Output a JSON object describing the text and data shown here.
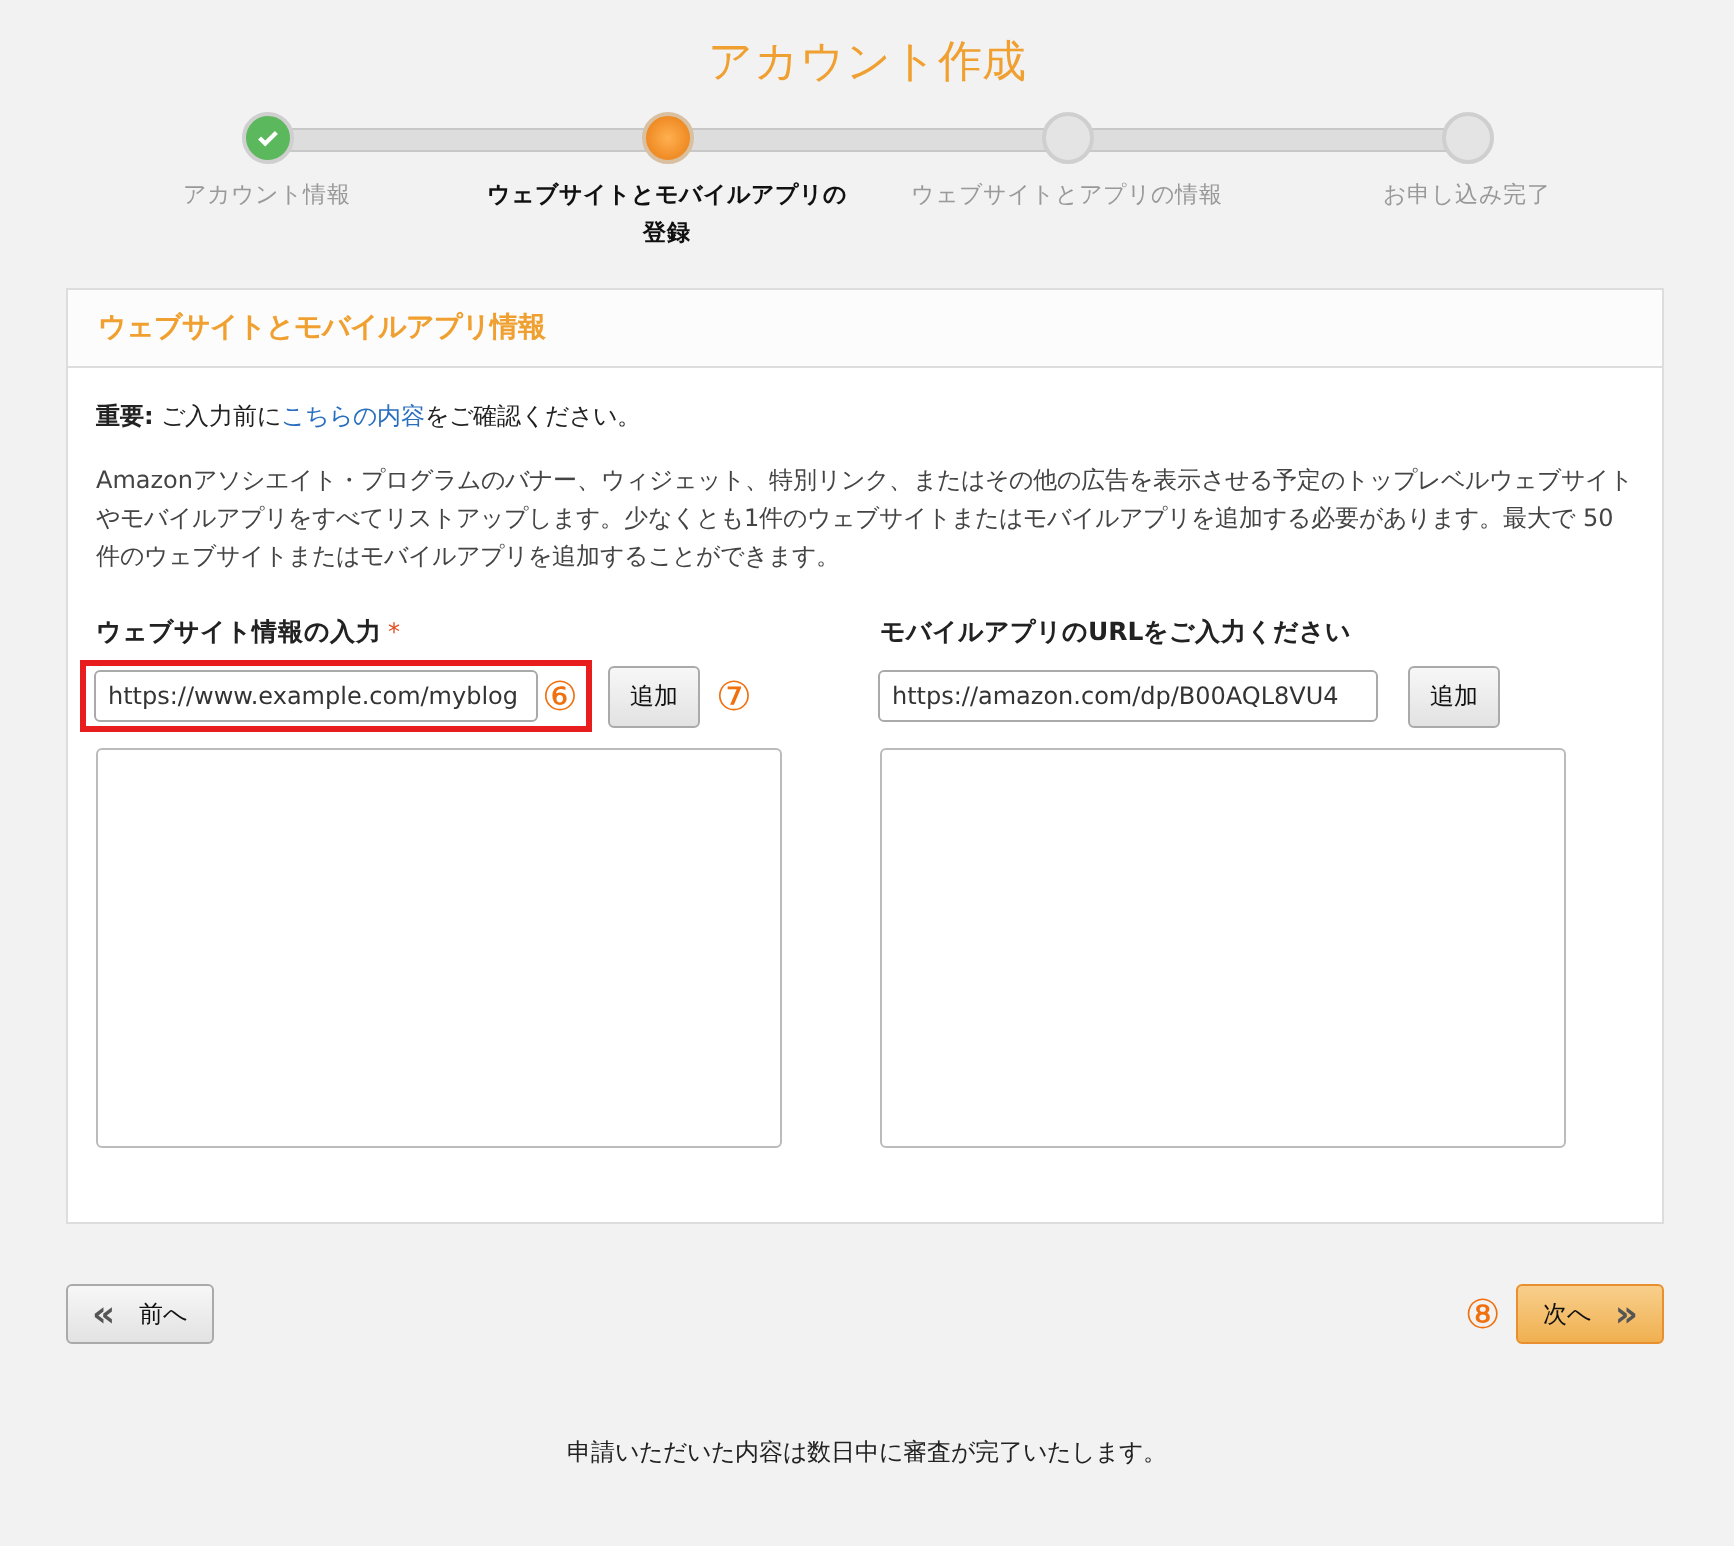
{
  "title": "アカウント作成",
  "steps": [
    {
      "label": "アカウント情報",
      "done": true,
      "selected": false
    },
    {
      "label": "ウェブサイトとモバイルアプリの登録",
      "done": false,
      "selected": true
    },
    {
      "label": "ウェブサイトとアプリの情報",
      "done": false,
      "selected": false
    },
    {
      "label": "お申し込み完了",
      "done": false,
      "selected": false
    }
  ],
  "card": {
    "heading": "ウェブサイトとモバイルアプリ情報",
    "notice": {
      "label": "重要:",
      "before": " ご入力前に",
      "link": "こちらの内容",
      "after": "をご確認ください。"
    },
    "description": "Amazonアソシエイト・プログラムのバナー、ウィジェット、特別リンク、またはその他の広告を表示させる予定のトップレベルウェブサイトやモバイルアプリをすべてリストアップします。少なくとも1件のウェブサイトまたはモバイルアプリを追加する必要があります。最大で 50 件のウェブサイトまたはモバイルアプリを追加することができます。",
    "columns": [
      {
        "label": "ウェブサイト情報の入力",
        "required_mark": "*",
        "value": "https://www.example.com/myblog",
        "highlighted": true,
        "field_marker": "⑥",
        "button": "追加",
        "button_marker": "⑦"
      },
      {
        "label": "モバイルアプリのURLをご入力ください",
        "value": "https://amazon.com/dp/B00AQL8VU4",
        "highlighted": false,
        "button": "追加"
      }
    ]
  },
  "prev_button": {
    "icon": "«",
    "label": "前へ"
  },
  "next_button": {
    "marker": "⑧",
    "label": "次へ",
    "icon": "»"
  },
  "footer": "申請いただいた内容は数日中に審査が完了いたします。"
}
